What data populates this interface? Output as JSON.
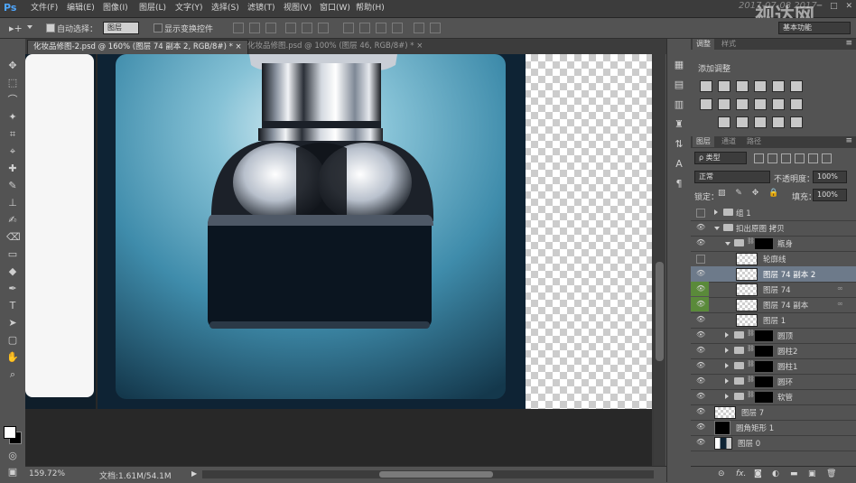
{
  "app": {
    "logo": "Ps",
    "watermark_date": "2017-07-08 2017"
  },
  "menu": [
    "文件(F)",
    "编辑(E)",
    "图像(I)",
    "图层(L)",
    "文字(Y)",
    "选择(S)",
    "滤镜(T)",
    "视图(V)",
    "窗口(W)",
    "帮助(H)"
  ],
  "options": {
    "auto_select_label": "自动选择：",
    "auto_select_value": "图层",
    "show_transform_label": "显示变换控件",
    "workspace": "基本功能"
  },
  "tabs": [
    {
      "label": "化妆品修图-2.psd @ 160% (图层 74 副本 2, RGB/8#) *",
      "active": true
    },
    {
      "label": "化妆品修图.psd @ 100% (图层 46, RGB/8#) *",
      "active": false
    }
  ],
  "status": {
    "zoom": "159.72%",
    "doc": "文档:1.61M/54.1M"
  },
  "panels": {
    "adjust_tabs": [
      "调整",
      "样式"
    ],
    "adjust_title": "添加调整",
    "layer_tabs": [
      "图层",
      "通道",
      "路径"
    ],
    "filter_kind": "ρ 类型",
    "blend_mode": "正常",
    "opacity_label": "不透明度：",
    "opacity_value": "100%",
    "lock_label": "锁定：",
    "fill_label": "填充：",
    "fill_value": "100%"
  },
  "layers": [
    {
      "name": "组 1",
      "type": "group",
      "indent": 0,
      "expanded": false,
      "visible": false
    },
    {
      "name": "扣出原图 拷贝",
      "type": "group",
      "indent": 0,
      "expanded": true,
      "visible": true
    },
    {
      "name": "瓶身",
      "type": "group-mask",
      "indent": 1,
      "expanded": true,
      "visible": true
    },
    {
      "name": "轮廓线",
      "type": "layer",
      "indent": 2,
      "visible": false
    },
    {
      "name": "图层 74 副本 2",
      "type": "layer",
      "indent": 2,
      "visible": true,
      "selected": true
    },
    {
      "name": "图层 74",
      "type": "layer",
      "indent": 2,
      "visible": true,
      "linked": true,
      "green": true
    },
    {
      "name": "图层 74 副本",
      "type": "layer",
      "indent": 2,
      "visible": true,
      "linked": true,
      "green": true
    },
    {
      "name": "图层 1",
      "type": "layer",
      "indent": 2,
      "visible": true
    },
    {
      "name": "圆顶",
      "type": "group-mask",
      "indent": 1,
      "expanded": false,
      "visible": true
    },
    {
      "name": "圆柱2",
      "type": "group-mask",
      "indent": 1,
      "expanded": false,
      "visible": true
    },
    {
      "name": "圆柱1",
      "type": "group-mask",
      "indent": 1,
      "expanded": false,
      "visible": true
    },
    {
      "name": "圆环",
      "type": "group-mask",
      "indent": 1,
      "expanded": false,
      "visible": true
    },
    {
      "name": "软管",
      "type": "group-mask",
      "indent": 1,
      "expanded": false,
      "visible": true
    },
    {
      "name": "图层 7",
      "type": "layer-chain",
      "indent": 0,
      "visible": true
    },
    {
      "name": "圆角矩形 1",
      "type": "shape",
      "indent": 0,
      "visible": true
    },
    {
      "name": "图层 0",
      "type": "layer-dark",
      "indent": 0,
      "visible": true
    }
  ],
  "watermark": "视达网"
}
